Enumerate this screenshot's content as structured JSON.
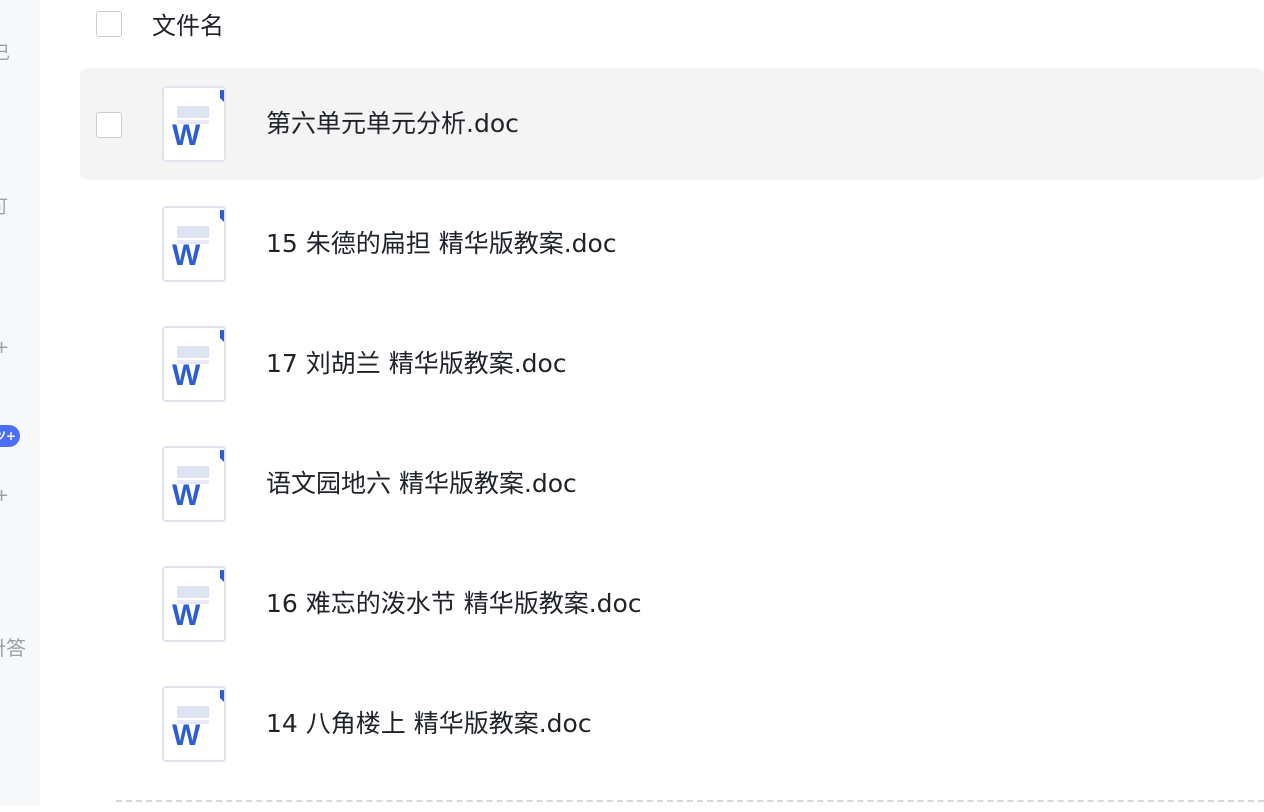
{
  "header": {
    "title": "文件名"
  },
  "left_strip": {
    "fragments": [
      "己",
      "可",
      "+",
      "+",
      "卌答"
    ],
    "badge": "ツ+"
  },
  "files": [
    {
      "name": "第六单元单元分析.doc",
      "type": "word",
      "icon_letter": "W",
      "selected": true
    },
    {
      "name": "15 朱德的扁担 精华版教案.doc",
      "type": "word",
      "icon_letter": "W",
      "selected": false
    },
    {
      "name": "17 刘胡兰 精华版教案.doc",
      "type": "word",
      "icon_letter": "W",
      "selected": false
    },
    {
      "name": "语文园地六 精华版教案.doc",
      "type": "word",
      "icon_letter": "W",
      "selected": false
    },
    {
      "name": "16 难忘的泼水节 精华版教案.doc",
      "type": "word",
      "icon_letter": "W",
      "selected": false
    },
    {
      "name": "14 八角楼上 精华版教案.doc",
      "type": "word",
      "icon_letter": "W",
      "selected": false
    }
  ],
  "colors": {
    "word_blue": "#2f5bd3",
    "selected_row_bg": "#f4f4f5"
  }
}
